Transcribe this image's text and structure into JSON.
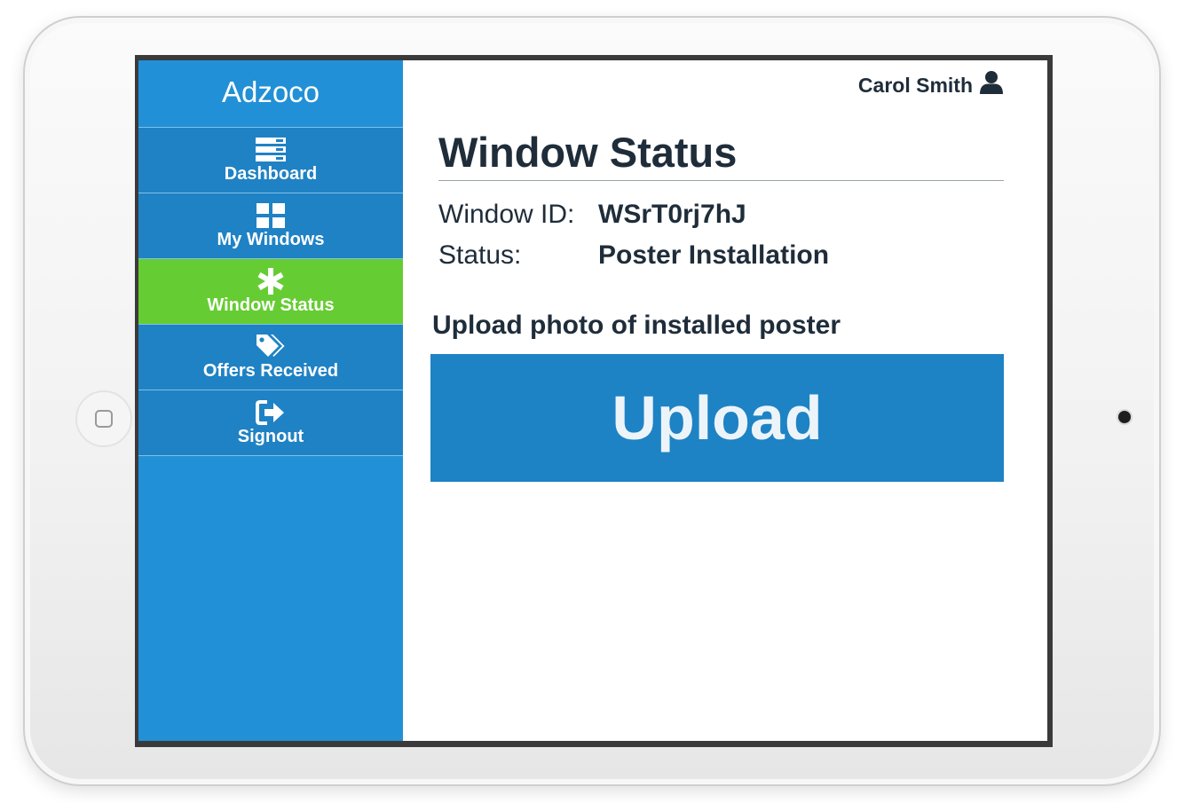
{
  "app": {
    "brand": "Adzoco"
  },
  "sidebar": {
    "items": [
      {
        "label": "Dashboard",
        "icon": "server-icon",
        "active": false
      },
      {
        "label": "My Windows",
        "icon": "grid-icon",
        "active": false
      },
      {
        "label": "Window Status",
        "icon": "asterisk-icon",
        "active": true
      },
      {
        "label": "Offers Received",
        "icon": "tags-icon",
        "active": false
      },
      {
        "label": "Signout",
        "icon": "signout-icon",
        "active": false
      }
    ]
  },
  "header": {
    "user_name": "Carol Smith",
    "user_icon": "user-icon"
  },
  "main": {
    "title": "Window Status",
    "window_id_label": "Window ID:",
    "window_id_value": "WSrT0rj7hJ",
    "status_label": "Status:",
    "status_value": "Poster Installation",
    "upload_heading": "Upload photo of installed poster",
    "upload_button": "Upload"
  },
  "colors": {
    "sidebar_bg": "#2290d6",
    "nav_item_bg": "#1f82c4",
    "active_bg": "#66cc33",
    "text_dark": "#1f2d3a",
    "upload_bg": "#1d83c4"
  }
}
